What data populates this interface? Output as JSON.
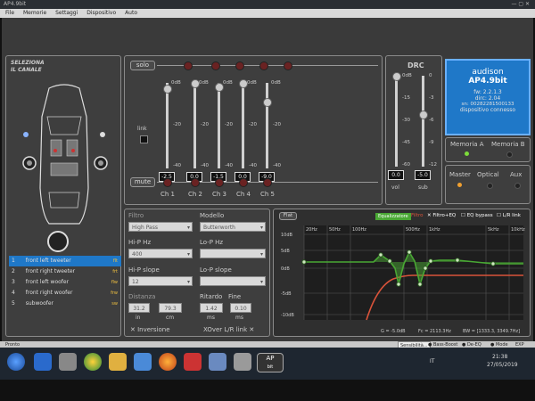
{
  "window": {
    "title": "AP4.9bit"
  },
  "menu": [
    "File",
    "Memorie",
    "Settaggi",
    "Dispositivo",
    "Auto"
  ],
  "left": {
    "title_line1": "SELEZIONA",
    "title_line2": "IL CANALE",
    "channels": [
      {
        "num": "1",
        "name": "front left tweeter",
        "tag": "flt"
      },
      {
        "num": "2",
        "name": "front right tweeter",
        "tag": "frt"
      },
      {
        "num": "3",
        "name": "front left woofer",
        "tag": "flw"
      },
      {
        "num": "4",
        "name": "front right woofer",
        "tag": "frw"
      },
      {
        "num": "5",
        "name": "subwoofer",
        "tag": "sw"
      }
    ]
  },
  "mixer": {
    "solo": "solo",
    "mute": "mute",
    "link": "link",
    "scale": [
      "0dB",
      "-20",
      "-40"
    ],
    "channels": [
      {
        "label": "Ch 1",
        "value": "-2.5",
        "level": 0.94
      },
      {
        "label": "Ch 2",
        "value": "0.0",
        "level": 1.0
      },
      {
        "label": "Ch 3",
        "value": "-1.5",
        "level": 0.96
      },
      {
        "label": "Ch 4",
        "value": "0.0",
        "level": 1.0
      },
      {
        "label": "Ch 5",
        "value": "-9.0",
        "level": 0.78
      }
    ]
  },
  "drc": {
    "title": "DRC",
    "vol_scale": [
      "0dB",
      "-15",
      "-30",
      "-45",
      "-60"
    ],
    "sub_scale": [
      "0",
      "-3",
      "-6",
      "-9",
      "-12"
    ],
    "vol_value": "0.0",
    "sub_value": "-5.0",
    "vol_label": "vol",
    "sub_label": "sub",
    "vol_level": 1.0,
    "sub_level": 0.58
  },
  "device": {
    "brand": "audison",
    "model": "AP4.9bit",
    "fw": "fw: 2.2.1.3",
    "dirc": "dirc: 2.04",
    "sn": "sn: 00282281500133",
    "status": "dispositivo connesso"
  },
  "memory": {
    "a": "Memoria A",
    "b": "Memoria B"
  },
  "source": {
    "master": "Master",
    "optical": "Optical",
    "aux": "Aux"
  },
  "filter": {
    "filtro_label": "Filtro",
    "filtro_value": "High Pass",
    "modello_label": "Modello",
    "modello_value": "Butterworth",
    "hip_hz_label": "Hi-P Hz",
    "hip_hz_value": "400",
    "lop_hz_label": "Lo-P Hz",
    "lop_hz_value": "",
    "hip_slope_label": "Hi-P slope",
    "hip_slope_value": "12",
    "lop_slope_label": "Lo-P slope",
    "lop_slope_value": "",
    "distanza_label": "Distanza",
    "dist_in": "31.2",
    "dist_in_unit": "in",
    "dist_cm": "79.3",
    "dist_cm_unit": "cm",
    "ritardo_label": "Ritardo",
    "ritardo_value": "1.42",
    "ritardo_unit": "ms",
    "fine_label": "Fine",
    "fine_value": "0.10",
    "fine_unit": "ms",
    "inversione": "Inversione",
    "xover_link": "XOver L/R link"
  },
  "eq": {
    "flat": "Flat",
    "equalizzatore": "Equalizzatore",
    "filtro": "Filtro",
    "filtro_eq": "Filtro+EQ",
    "eq_bypass": "EQ bypass",
    "lr_link": "L/R link",
    "freq_ticks": [
      "20Hz",
      "50Hz",
      "100Hz",
      "500Hz",
      "1kHz",
      "5kHz",
      "10kHz"
    ],
    "db_ticks": [
      "10dB",
      "5dB",
      "0dB",
      "-5dB",
      "-10dB"
    ],
    "readout_g": "G = -5.0dB",
    "readout_fc": "Fc = 2113.3Hz",
    "readout_bw": "BW = [1333.3, 3349.7Hz]"
  },
  "bottom": {
    "pronto": "Pronto",
    "sensibilita": "Sensibilità...",
    "bass_boost": "Bass-Boost",
    "de_eq": "De-EQ",
    "mode": "Mode",
    "exp": "EXP"
  },
  "taskbar": {
    "lang": "IT",
    "time": "21:38",
    "date": "27/05/2019",
    "app_label": "AP",
    "app_sub": "bit"
  },
  "colors": {
    "accent_blue": "#1f78c8",
    "eq_green": "#49a834",
    "filter_red": "#d9533a"
  }
}
